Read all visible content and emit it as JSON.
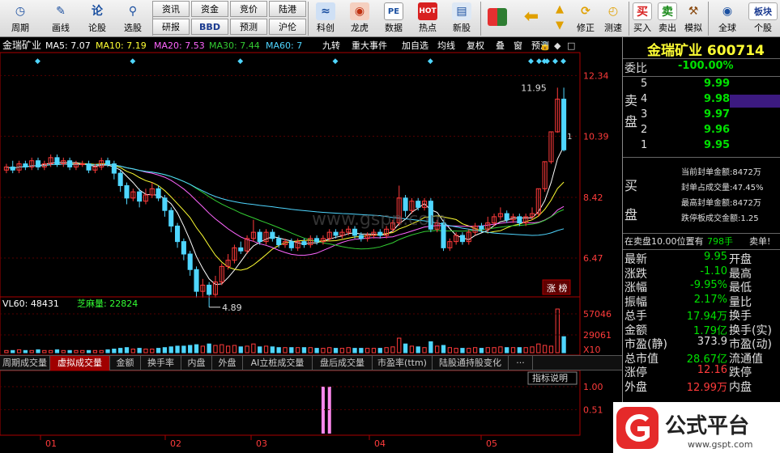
{
  "toolbar": {
    "items": [
      {
        "label": "周期",
        "icon": "clock-icon"
      },
      {
        "label": "画线",
        "icon": "pencil-icon"
      },
      {
        "label": "论股",
        "icon": "lungu-icon"
      },
      {
        "label": "选股",
        "icon": "search-chart-icon"
      }
    ],
    "text_buttons_row1": [
      "资讯",
      "资金",
      "竞价",
      "陆港"
    ],
    "text_buttons_row2": [
      "研报",
      "BBD",
      "预测",
      "沪伦"
    ],
    "right_items": [
      {
        "label": "科创",
        "icon": "chart-icon"
      },
      {
        "label": "龙虎",
        "icon": "tiger-icon"
      },
      {
        "label": "数据",
        "icon": "pe-icon"
      },
      {
        "label": "热点",
        "icon": "hot-icon"
      },
      {
        "label": "新股",
        "icon": "newstock-icon"
      }
    ],
    "far_right": [
      {
        "label": "修正",
        "icon": "refresh-icon"
      },
      {
        "label": "测速",
        "icon": "speed-icon"
      },
      {
        "label": "买入",
        "icon": "buy-icon",
        "glyph": "买"
      },
      {
        "label": "卖出",
        "icon": "sell-icon",
        "glyph": "卖"
      },
      {
        "label": "模拟",
        "icon": "hammer-icon"
      },
      {
        "label": "全球",
        "icon": "globe-icon"
      },
      {
        "label": "个股",
        "icon": "stock-icon",
        "glyph": "板块"
      }
    ]
  },
  "chart_header": {
    "name": "金瑞矿业",
    "ma5": "MA5: 7.07",
    "ma10": "MA10: 7.19",
    "ma20": "MA20: 7.53",
    "ma30": "MA30: 7.44",
    "ma60": "MA60: 7",
    "buttons": [
      "九转",
      "重大事件",
      "加自选",
      "均线",
      "复权",
      "叠",
      "窗",
      "预测"
    ]
  },
  "chart_data": [
    {
      "type": "candlestick",
      "y_ticks": [
        "12.34",
        "10.39",
        "8.42",
        "6.47"
      ],
      "y_tick_values": [
        12.34,
        10.39,
        8.42,
        6.47
      ],
      "ylim": [
        5.3,
        13.0
      ],
      "annotations": [
        {
          "text": "11.95",
          "value": 11.95
        },
        {
          "text": "4.89",
          "value": 4.89
        },
        {
          "text": "1",
          "value": 10.3
        }
      ],
      "badge": "涨 榜",
      "candles": [
        [
          9.3,
          9.4,
          9.5,
          9.2
        ],
        [
          9.4,
          9.3,
          9.6,
          9.2
        ],
        [
          9.3,
          9.5,
          9.6,
          9.2
        ],
        [
          9.5,
          9.4,
          9.6,
          9.3
        ],
        [
          9.4,
          9.6,
          9.7,
          9.3
        ],
        [
          9.6,
          9.4,
          9.7,
          9.3
        ],
        [
          9.4,
          9.5,
          9.6,
          9.3
        ],
        [
          9.5,
          9.7,
          9.8,
          9.4
        ],
        [
          9.7,
          9.5,
          9.8,
          9.4
        ],
        [
          9.5,
          9.6,
          9.7,
          9.4
        ],
        [
          9.6,
          9.4,
          9.7,
          9.3
        ],
        [
          9.4,
          9.5,
          9.6,
          9.3
        ],
        [
          9.5,
          9.5,
          9.6,
          9.4
        ],
        [
          9.5,
          9.3,
          9.6,
          9.2
        ],
        [
          9.3,
          9.4,
          9.5,
          9.2
        ],
        [
          9.4,
          9.6,
          9.7,
          9.3
        ],
        [
          9.6,
          9.5,
          9.7,
          9.4
        ],
        [
          9.5,
          9.2,
          9.6,
          9.0
        ],
        [
          9.2,
          8.8,
          9.3,
          8.6
        ],
        [
          8.8,
          8.4,
          8.9,
          8.2
        ],
        [
          8.4,
          8.6,
          8.7,
          8.3
        ],
        [
          8.6,
          8.3,
          8.7,
          8.1
        ],
        [
          8.3,
          8.5,
          8.7,
          8.2
        ],
        [
          8.5,
          8.7,
          8.9,
          8.4
        ],
        [
          8.7,
          8.4,
          8.8,
          8.3
        ],
        [
          8.4,
          8.0,
          8.5,
          7.8
        ],
        [
          8.0,
          7.5,
          8.1,
          7.3
        ],
        [
          7.5,
          7.0,
          7.6,
          6.8
        ],
        [
          7.0,
          6.6,
          7.1,
          6.4
        ],
        [
          6.6,
          6.1,
          6.7,
          5.9
        ],
        [
          6.1,
          5.4,
          6.2,
          5.2
        ],
        [
          5.4,
          5.6,
          5.8,
          5.2
        ],
        [
          5.6,
          5.3,
          5.7,
          4.89
        ],
        [
          5.3,
          5.7,
          5.9,
          5.2
        ],
        [
          5.7,
          6.2,
          6.3,
          5.6
        ],
        [
          6.2,
          6.4,
          6.6,
          6.1
        ],
        [
          6.4,
          6.8,
          6.9,
          6.3
        ],
        [
          6.8,
          6.7,
          7.0,
          6.6
        ],
        [
          6.7,
          7.1,
          7.2,
          6.6
        ],
        [
          7.1,
          7.3,
          7.7,
          7.0
        ],
        [
          7.3,
          7.0,
          7.4,
          6.9
        ],
        [
          7.0,
          7.3,
          7.4,
          6.9
        ],
        [
          7.3,
          7.1,
          7.4,
          7.0
        ],
        [
          7.1,
          6.9,
          7.2,
          6.8
        ],
        [
          6.9,
          7.0,
          7.1,
          6.8
        ],
        [
          7.0,
          6.8,
          7.1,
          6.7
        ],
        [
          6.8,
          7.0,
          7.1,
          6.7
        ],
        [
          7.0,
          6.9,
          7.1,
          6.8
        ],
        [
          6.9,
          7.1,
          7.2,
          6.8
        ],
        [
          7.1,
          7.0,
          7.2,
          6.9
        ],
        [
          7.0,
          7.1,
          7.2,
          6.9
        ],
        [
          7.1,
          7.3,
          7.4,
          7.0
        ],
        [
          7.3,
          7.2,
          7.4,
          7.1
        ],
        [
          7.2,
          7.3,
          7.4,
          7.1
        ],
        [
          7.3,
          7.4,
          7.5,
          7.2
        ],
        [
          7.4,
          7.2,
          7.5,
          7.1
        ],
        [
          7.2,
          7.1,
          7.3,
          7.0
        ],
        [
          7.1,
          7.2,
          7.3,
          7.0
        ],
        [
          7.2,
          7.3,
          7.4,
          7.1
        ],
        [
          7.3,
          7.2,
          7.4,
          7.1
        ],
        [
          7.2,
          7.4,
          7.5,
          7.1
        ],
        [
          7.4,
          7.6,
          7.7,
          7.3
        ],
        [
          7.6,
          8.4,
          8.8,
          7.5
        ],
        [
          8.4,
          8.0,
          8.5,
          7.8
        ],
        [
          8.0,
          8.3,
          8.4,
          7.9
        ],
        [
          8.3,
          8.1,
          8.4,
          8.0
        ],
        [
          8.1,
          8.3,
          8.4,
          8.0
        ],
        [
          8.3,
          7.4,
          8.4,
          7.3
        ],
        [
          7.4,
          7.6,
          7.7,
          7.3
        ],
        [
          7.6,
          6.8,
          7.7,
          6.7
        ],
        [
          6.8,
          7.0,
          7.1,
          6.7
        ],
        [
          7.0,
          7.2,
          7.3,
          6.9
        ],
        [
          7.2,
          7.0,
          7.3,
          6.9
        ],
        [
          7.0,
          7.3,
          7.4,
          6.9
        ],
        [
          7.3,
          7.5,
          7.6,
          7.2
        ],
        [
          7.5,
          7.4,
          7.6,
          7.3
        ],
        [
          7.4,
          7.6,
          7.8,
          7.3
        ],
        [
          7.6,
          7.8,
          7.9,
          7.5
        ],
        [
          7.8,
          7.9,
          8.1,
          7.7
        ],
        [
          7.9,
          7.7,
          8.0,
          7.6
        ],
        [
          7.7,
          7.8,
          7.9,
          7.6
        ],
        [
          7.8,
          7.6,
          7.9,
          7.5
        ],
        [
          7.6,
          7.8,
          7.9,
          7.5
        ],
        [
          7.8,
          7.9,
          8.1,
          7.7
        ],
        [
          7.9,
          8.7,
          8.7,
          7.8
        ],
        [
          8.7,
          9.57,
          9.57,
          8.6
        ],
        [
          9.57,
          10.53,
          10.53,
          9.5
        ],
        [
          10.53,
          11.58,
          11.95,
          10.5
        ],
        [
          11.58,
          9.95,
          11.95,
          9.9
        ]
      ]
    },
    {
      "type": "bar",
      "title": "VL60: 48431",
      "indicator": "芝麻量: 22824",
      "y_ticks": [
        "57046",
        "29061"
      ],
      "unit": "X10",
      "values": [
        3,
        3,
        4,
        3,
        3,
        4,
        3,
        3,
        4,
        3,
        3,
        3,
        3,
        3,
        3,
        3,
        4,
        5,
        6,
        7,
        5,
        6,
        5,
        5,
        6,
        7,
        8,
        9,
        9,
        10,
        11,
        9,
        12,
        10,
        11,
        9,
        10,
        8,
        9,
        12,
        8,
        9,
        8,
        7,
        7,
        7,
        7,
        7,
        7,
        6,
        6,
        7,
        6,
        6,
        7,
        6,
        6,
        6,
        6,
        6,
        7,
        8,
        20,
        12,
        9,
        8,
        7,
        15,
        9,
        10,
        7,
        6,
        6,
        6,
        7,
        6,
        7,
        7,
        8,
        7,
        7,
        7,
        7,
        8,
        12,
        10,
        9,
        60,
        22
      ]
    },
    {
      "type": "bar",
      "y_ticks": [
        "1.00",
        "0.51"
      ],
      "button": "指标说明",
      "values": [
        0,
        0,
        0,
        0,
        0,
        0,
        0,
        0,
        0,
        0,
        0,
        0,
        0,
        0,
        0,
        0,
        0,
        0,
        0,
        0,
        0,
        0,
        0,
        0,
        0,
        0,
        0,
        0,
        0,
        0,
        0,
        0,
        0,
        0,
        0,
        0,
        0,
        0,
        0,
        0,
        0,
        0,
        0,
        0,
        0,
        0,
        0,
        0,
        0,
        0,
        1,
        1,
        0,
        0,
        0,
        0,
        0,
        0,
        0,
        0,
        0,
        0,
        0,
        0,
        0,
        0,
        0,
        0,
        0,
        0,
        0,
        0,
        0,
        0,
        0,
        0,
        0,
        0,
        0,
        0,
        0,
        0,
        0,
        0,
        0,
        0,
        0,
        0,
        0
      ]
    }
  ],
  "x_axis": [
    "01",
    "02",
    "03",
    "04",
    "05"
  ],
  "tabs": [
    "周期成交量",
    "虚拟成交量",
    "金额",
    "换手率",
    "内盘",
    "外盘",
    "AI立桩成交量",
    "盘后成交量",
    "市盈率(ttm)",
    "陆股通持股变化",
    "···"
  ],
  "panel": {
    "title": "金瑞矿业 600714",
    "weibi_label": "委比",
    "weibi_value": "-100.00%",
    "sell_label": "卖盘",
    "sell": [
      {
        "level": "5",
        "price": "9.99"
      },
      {
        "level": "4",
        "price": "9.98"
      },
      {
        "level": "3",
        "price": "9.97"
      },
      {
        "level": "2",
        "price": "9.96"
      },
      {
        "level": "1",
        "price": "9.95"
      }
    ],
    "buy_label": "买盘",
    "buy_info": [
      "当前封单金额:8472万",
      "封单占成交量:47.45%",
      "最高封单金额:8472万",
      "跌停板成交金额:1.25"
    ],
    "status_text": "在卖盘10.00位置有",
    "status_vol": "798手",
    "status_end": "卖单!",
    "stats": [
      {
        "l": "最新",
        "v": "9.95",
        "r": "开盘"
      },
      {
        "l": "涨跌",
        "v": "-1.10",
        "r": "最高"
      },
      {
        "l": "涨幅",
        "v": "-9.95%",
        "r": "最低"
      },
      {
        "l": "振幅",
        "v": "2.17%",
        "r": "量比"
      },
      {
        "l": "总手",
        "v": "17.94万",
        "r": "换手"
      },
      {
        "l": "金额",
        "v": "1.79亿",
        "r": "换手(实)"
      },
      {
        "l": "市盈(静)",
        "v": "373.9",
        "r": "市盈(动)"
      },
      {
        "l": "总市值",
        "v": "28.67亿",
        "r": "流通值"
      },
      {
        "l": "涨停",
        "v": "12.16",
        "r": "跌停"
      },
      {
        "l": "外盘",
        "v": "12.99万",
        "r": "内盘"
      }
    ]
  },
  "watermark": {
    "site": "www.gspn.com",
    "brand": "公式平台",
    "url": "www.gspt.com"
  },
  "colors": {
    "up": "#ff3b3b",
    "down": "#4fd6ff",
    "ma5": "#ffffff",
    "ma10": "#ffff33",
    "ma20": "#ff66ff",
    "ma30": "#33cc33",
    "ma60": "#4fd6ff"
  }
}
